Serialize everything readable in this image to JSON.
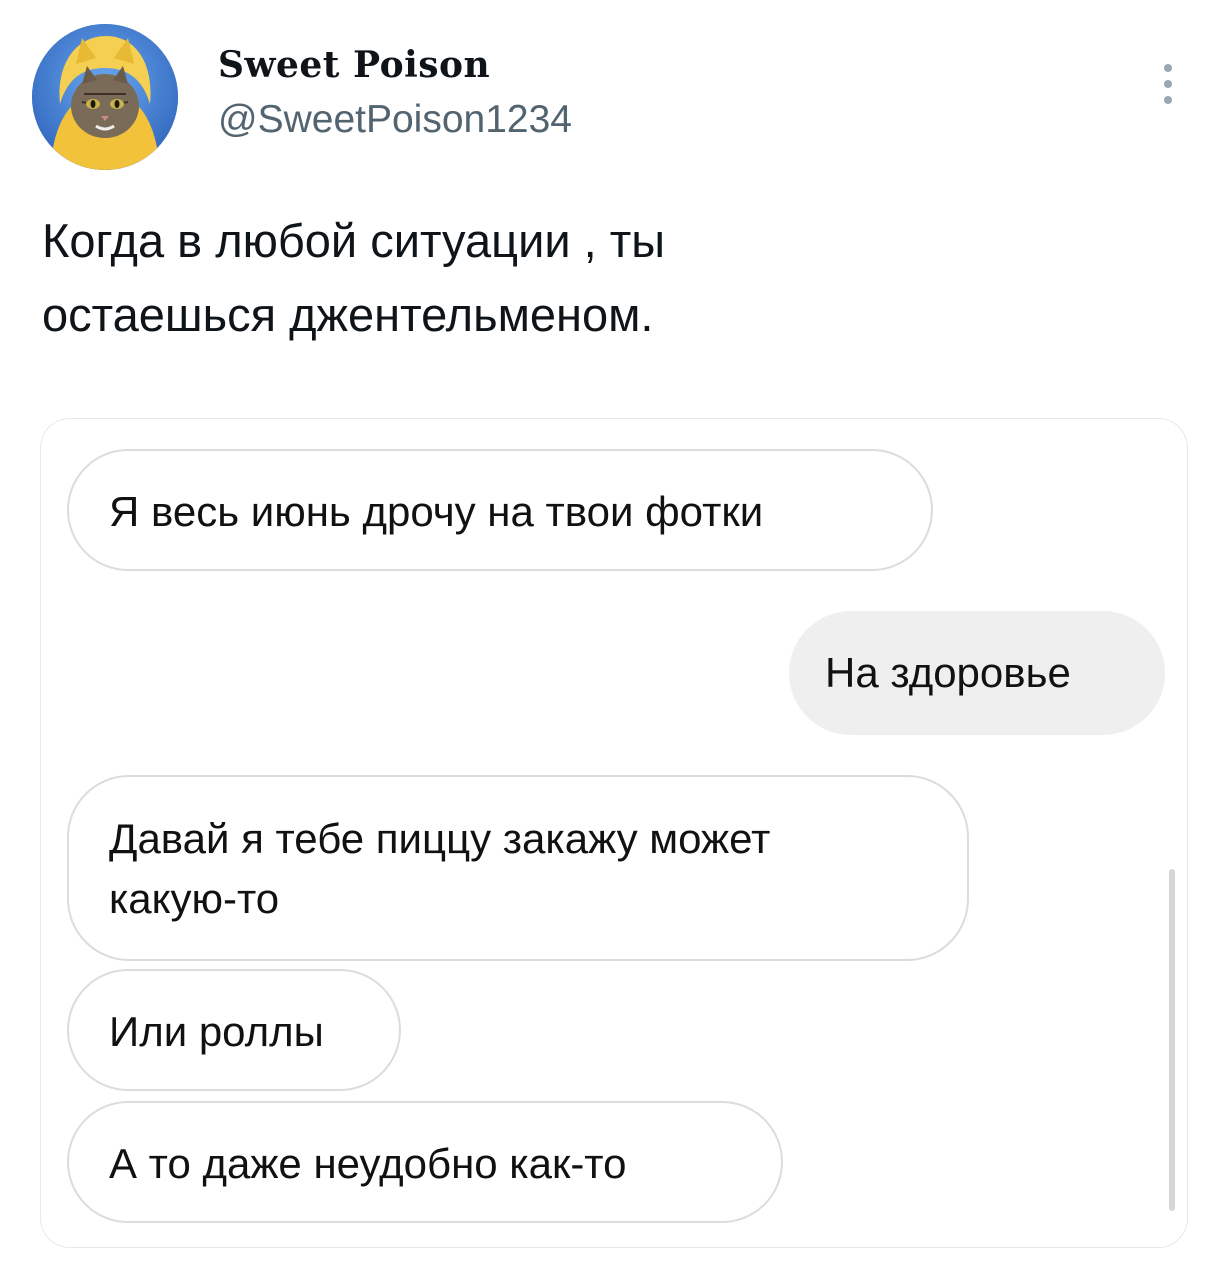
{
  "tweet": {
    "author": {
      "display_name": "Sweet Poison",
      "handle": "@SweetPoison1234",
      "avatar_icon": "cat-avatar-icon"
    },
    "more_icon": "more-options-icon",
    "text_line1": "Когда в любой ситуации , ты",
    "text_line2": "остаешься джентельменом."
  },
  "chat": {
    "messages": [
      {
        "direction": "incoming",
        "text": "Я весь июнь дрочу на твои фотки"
      },
      {
        "direction": "outgoing",
        "text": "На здоровье"
      },
      {
        "direction": "incoming",
        "line1": "Давай я тебе пиццу закажу может",
        "line2": "какую-то"
      },
      {
        "direction": "incoming",
        "text": "Или роллы"
      },
      {
        "direction": "incoming",
        "text": "А то даже неудобно как-то"
      }
    ]
  },
  "colors": {
    "text_primary": "#0f1419",
    "text_secondary": "#536471",
    "bubble_outgoing_bg": "#efefef",
    "bubble_border": "#dcdcdc",
    "card_border": "#e6e9ec"
  }
}
